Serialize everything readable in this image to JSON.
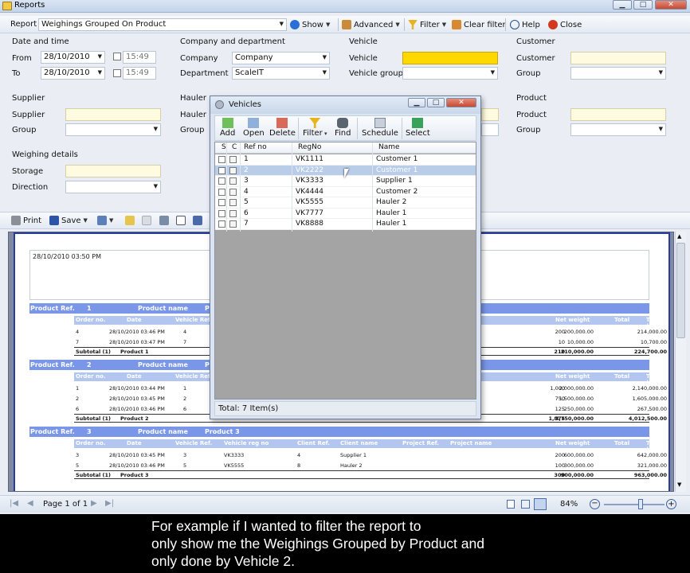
{
  "window": {
    "title": "Reports"
  },
  "toolbar": {
    "report_label": "Report",
    "report_value": "Weighings Grouped On Product",
    "show": "Show",
    "advanced": "Advanced",
    "filter": "Filter",
    "clear_filter": "Clear filter",
    "help": "Help",
    "close": "Close"
  },
  "filters": {
    "date": {
      "title": "Date and time",
      "from_label": "From",
      "from_date": "28/10/2010",
      "from_time": "15:49",
      "to_label": "To",
      "to_date": "28/10/2010",
      "to_time": "15:49"
    },
    "company": {
      "title": "Company and department",
      "company_label": "Company",
      "company_value": "Company",
      "department_label": "Department",
      "department_value": "ScaleIT"
    },
    "vehicle": {
      "title": "Vehicle",
      "vehicle_label": "Vehicle",
      "vehicle_value": "",
      "group_label": "Vehicle group",
      "group_value": ""
    },
    "customer": {
      "title": "Customer",
      "customer_label": "Customer",
      "customer_value": "",
      "group_label": "Group",
      "group_value": ""
    },
    "supplier": {
      "title": "Supplier",
      "supplier_label": "Supplier",
      "supplier_value": "",
      "group_label": "Group",
      "group_value": ""
    },
    "hauler": {
      "title": "Hauler",
      "hauler_label": "Hauler",
      "group_label": "Group"
    },
    "product": {
      "title": "Product",
      "product_label": "Product",
      "product_value": "",
      "group_label": "Group",
      "group_value": ""
    },
    "weighing": {
      "title": "Weighing details",
      "storage_label": "Storage",
      "storage_value": "",
      "direction_label": "Direction",
      "direction_value": ""
    }
  },
  "report_toolbar": {
    "print": "Print",
    "save": "Save"
  },
  "report": {
    "timestamp": "28/10/2010 03:50 PM",
    "band_labels": {
      "product_ref": "Product Ref.",
      "product_name": "Product name"
    },
    "columns": {
      "order_no": "Order no.",
      "date": "Date",
      "vehicle_ref": "Vehicle Ref.",
      "vehicle_reg": "Vehicle reg no",
      "client_ref": "Client Ref.",
      "client_name": "Client name",
      "project_ref": "Project Ref.",
      "project_name": "Project name",
      "net_weight": "Net weight",
      "total": "Total",
      "total_tax": "Total (with tax)"
    },
    "groups": [
      {
        "ref": "1",
        "name_short": "P",
        "rows": [
          {
            "order": "4",
            "date": "28/10/2010 03:46 PM",
            "veh": "4",
            "net": "200",
            "total": "200,000.00",
            "tax": "214,000.00"
          },
          {
            "order": "7",
            "date": "28/10/2010 03:47 PM",
            "veh": "7",
            "net": "10",
            "total": "10,000.00",
            "tax": "10,700.00"
          }
        ],
        "subtotal": {
          "label": "Subtotal (1)",
          "product": "Product 1",
          "net": "210",
          "total": "210,000.00",
          "tax": "224,700.00"
        }
      },
      {
        "ref": "2",
        "name_short": "P",
        "rows": [
          {
            "order": "1",
            "date": "28/10/2010 03:44 PM",
            "veh": "1",
            "net": "1,000",
            "total": "2,000,000.00",
            "tax": "2,140,000.00"
          },
          {
            "order": "2",
            "date": "28/10/2010 03:45 PM",
            "veh": "2",
            "net": "750",
            "total": "1,500,000.00",
            "tax": "1,605,000.00"
          },
          {
            "order": "6",
            "date": "28/10/2010 03:46 PM",
            "veh": "6",
            "net": "125",
            "total": "250,000.00",
            "tax": "267,500.00"
          }
        ],
        "subtotal": {
          "label": "Subtotal (1)",
          "product": "Product 2",
          "net": "1,875",
          "total": "3,750,000.00",
          "tax": "4,012,500.00"
        }
      },
      {
        "ref": "3",
        "name": "Product 3",
        "rows": [
          {
            "order": "3",
            "date": "28/10/2010 03:45 PM",
            "veh": "3",
            "reg": "VK3333",
            "client_ref": "4",
            "client": "Supplier 1",
            "net": "200",
            "total": "600,000.00",
            "tax": "642,000.00"
          },
          {
            "order": "5",
            "date": "28/10/2010 03:46 PM",
            "veh": "5",
            "reg": "VK5555",
            "client_ref": "8",
            "client": "Hauler 2",
            "net": "100",
            "total": "300,000.00",
            "tax": "321,000.00"
          }
        ],
        "subtotal": {
          "label": "Subtotal (1)",
          "product": "Product 3",
          "net": "300",
          "total": "900,000.00",
          "tax": "963,000.00"
        }
      }
    ]
  },
  "statusbar": {
    "page": "Page 1 of 1",
    "zoom": "84%",
    "zoom_fraction": 0.6
  },
  "dialog": {
    "title": "Vehicles",
    "buttons": {
      "add": "Add",
      "open": "Open",
      "delete": "Delete",
      "filter": "Filter",
      "find": "Find",
      "schedule": "Schedule",
      "select": "Select"
    },
    "headers": {
      "s": "S",
      "c": "C",
      "ref": "Ref no",
      "reg": "RegNo",
      "name": "Name"
    },
    "rows": [
      {
        "ref": "1",
        "reg": "VK1111",
        "name": "Customer 1"
      },
      {
        "ref": "2",
        "reg": "VK2222",
        "name": "Customer 1",
        "selected": true
      },
      {
        "ref": "3",
        "reg": "VK3333",
        "name": "Supplier 1"
      },
      {
        "ref": "4",
        "reg": "VK4444",
        "name": "Customer 2"
      },
      {
        "ref": "5",
        "reg": "VK5555",
        "name": "Hauler 2"
      },
      {
        "ref": "6",
        "reg": "VK7777",
        "name": "Hauler 1"
      },
      {
        "ref": "7",
        "reg": "VK8888",
        "name": "Hauler 1"
      }
    ],
    "footer": "Total: 7 Item(s)"
  },
  "subtitles": [
    "For example if I wanted to filter the report to",
    "only show me the Weighings Grouped by Product and",
    "only done by Vehicle 2."
  ],
  "colors": {
    "accent": "#7a96e8",
    "highlight_field": "#ffd800",
    "selected_row": "#b9cde9",
    "close_red": "#d23a20"
  }
}
